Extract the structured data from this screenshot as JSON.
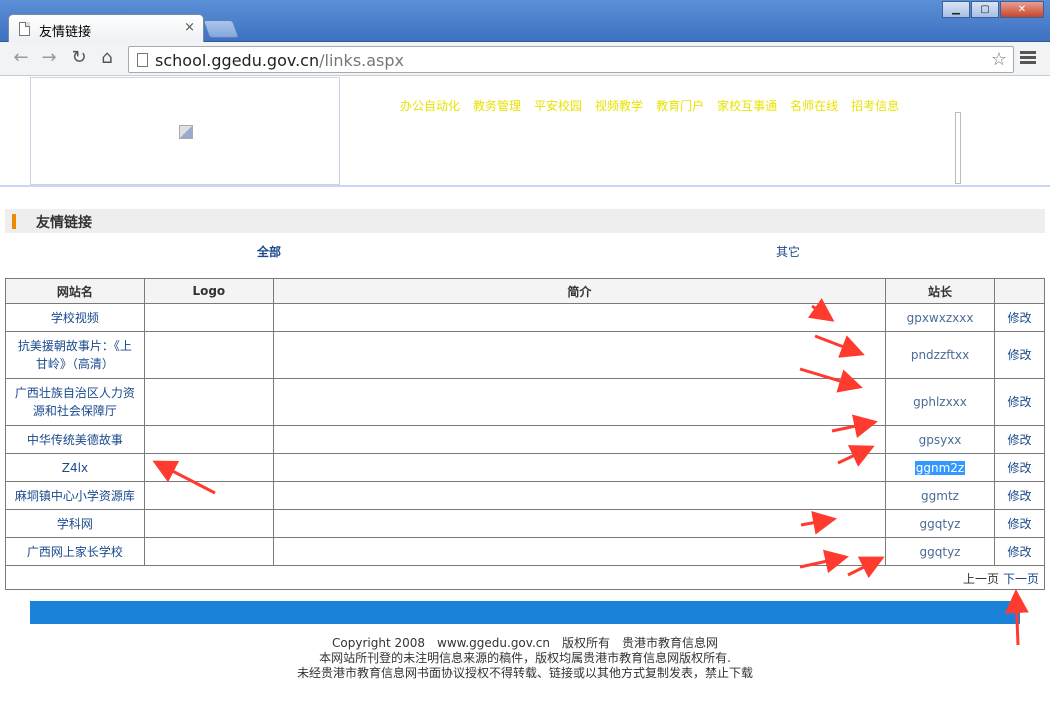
{
  "browser": {
    "tab_title": "友情链接",
    "tab_close": "×",
    "url_domain": "school.ggedu.gov.cn",
    "url_path": "/links.aspx",
    "win_minimize": "▁",
    "win_maximize": "▢",
    "win_close": "✕"
  },
  "header": {
    "nav": [
      "办公自动化",
      "教务管理",
      "平安校园",
      "视频教学",
      "教育门户",
      "家校互事通",
      "名师在线",
      "招考信息"
    ]
  },
  "section": {
    "title": "友情链接"
  },
  "filters": {
    "all": "全部",
    "other": "其它"
  },
  "table": {
    "headers": [
      "网站名",
      "Logo",
      "简介",
      "站长",
      ""
    ],
    "rows": [
      {
        "name": "学校视频",
        "admin": "gpxwxzxxx",
        "edit": "修改"
      },
      {
        "name": "抗美援朝故事片：《上甘岭》（高清）",
        "admin": "pndzzftxx",
        "edit": "修改"
      },
      {
        "name": "广西壮族自治区人力资源和社会保障厅",
        "admin": "gphlzxxx",
        "edit": "修改"
      },
      {
        "name": "中华传统美德故事",
        "admin": "gpsyxx",
        "edit": "修改"
      },
      {
        "name": "Z4lx",
        "admin": "ggnm2z",
        "edit": "修改"
      },
      {
        "name": "麻垌镇中心小学资源库",
        "admin": "ggmtz",
        "edit": "修改"
      },
      {
        "name": "学科网",
        "admin": "ggqtyz",
        "edit": "修改"
      },
      {
        "name": "广西网上家长学校",
        "admin": "ggqtyz",
        "edit": "修改"
      }
    ]
  },
  "pager": {
    "prev": "上一页",
    "next": "下一页"
  },
  "footer": {
    "line1": "Copyright 2008　www.ggedu.gov.cn　版权所有　贵港市教育信息网",
    "line2": "本网站所刊登的未注明信息来源的稿件，版权均属贵港市教育信息网版权所有.",
    "line3": "未经贵港市教育信息网书面协议授权不得转载、链接或以其他方式复制发表，禁止下载"
  },
  "colors": {
    "accent": "#1a82d8",
    "link": "#1a4a8c",
    "nav_text": "#e8e300",
    "annotation": "#ff3b30"
  }
}
